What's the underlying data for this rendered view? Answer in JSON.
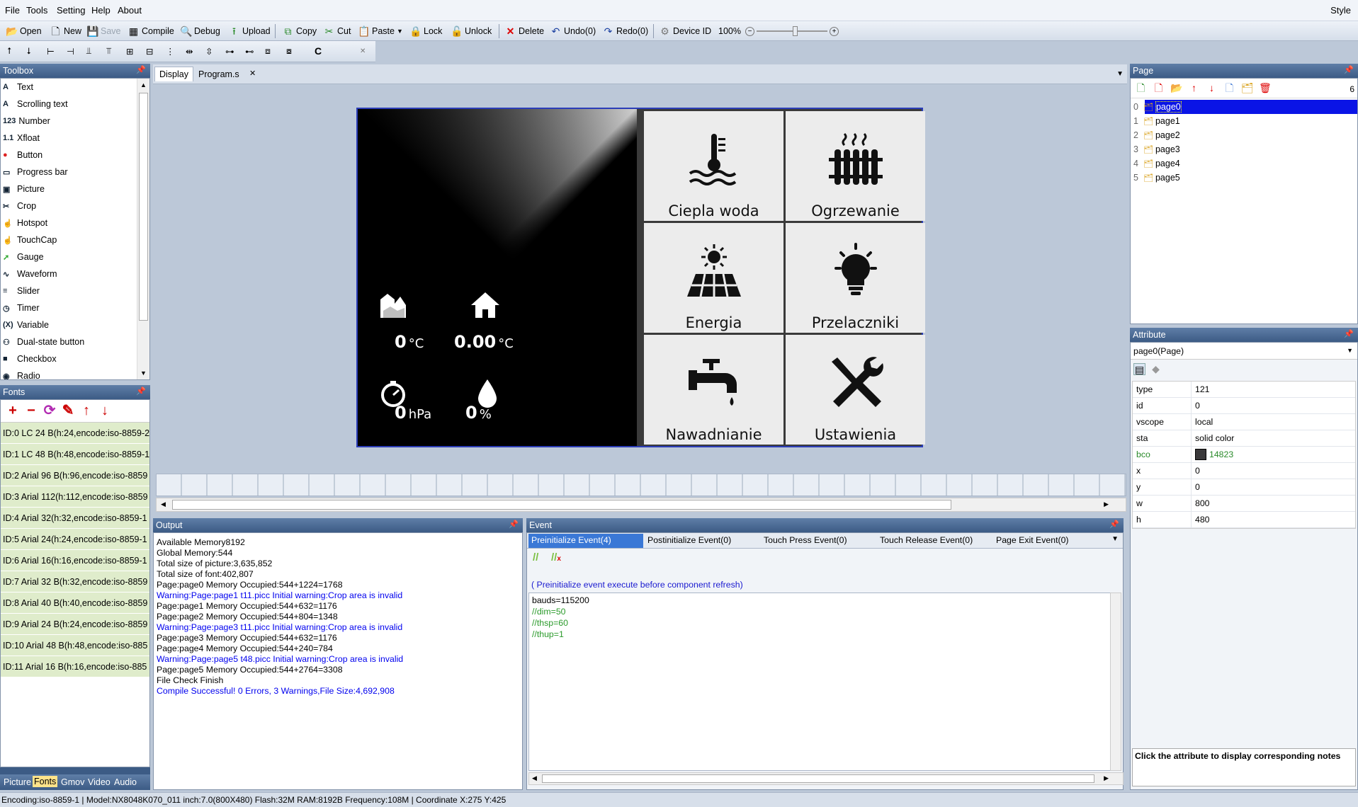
{
  "menu": {
    "file": "File",
    "tools": "Tools",
    "setting": "Setting",
    "help": "Help",
    "about": "About",
    "style": "Style"
  },
  "toolbar": {
    "open": "Open",
    "new": "New",
    "save": "Save",
    "compile": "Compile",
    "debug": "Debug",
    "upload": "Upload",
    "copy": "Copy",
    "cut": "Cut",
    "paste": "Paste",
    "lock": "Lock",
    "unlock": "Unlock",
    "delete": "Delete",
    "undo": "Undo(0)",
    "redo": "Redo(0)",
    "device_id": "Device ID",
    "zoom": "100%",
    "c_label": "C"
  },
  "toolbox": {
    "title": "Toolbox",
    "items": [
      {
        "icon": "A",
        "label": "Text"
      },
      {
        "icon": "A",
        "label": "Scrolling text"
      },
      {
        "icon": "123",
        "label": "Number"
      },
      {
        "icon": "1.1",
        "label": "Xfloat"
      },
      {
        "icon": "●",
        "label": "Button"
      },
      {
        "icon": "▭",
        "label": "Progress bar"
      },
      {
        "icon": "▣",
        "label": "Picture"
      },
      {
        "icon": "✂",
        "label": "Crop"
      },
      {
        "icon": "☝",
        "label": "Hotspot"
      },
      {
        "icon": "☝",
        "label": "TouchCap"
      },
      {
        "icon": "➚",
        "label": "Gauge"
      },
      {
        "icon": "∿",
        "label": "Waveform"
      },
      {
        "icon": "≡",
        "label": "Slider"
      },
      {
        "icon": "◷",
        "label": "Timer"
      },
      {
        "icon": "(X)",
        "label": "Variable"
      },
      {
        "icon": "⚇",
        "label": "Dual-state button"
      },
      {
        "icon": "■",
        "label": "Checkbox"
      },
      {
        "icon": "◉",
        "label": "Radio"
      }
    ]
  },
  "fonts": {
    "title": "Fonts",
    "items": [
      "ID:0  LC 24 B(h:24,encode:iso-8859-2",
      "ID:1  LC 48 B(h:48,encode:iso-8859-1",
      "ID:2  Arial 96 B(h:96,encode:iso-8859",
      "ID:3  Arial 112(h:112,encode:iso-8859",
      "ID:4  Arial 32(h:32,encode:iso-8859-1",
      "ID:5  Arial 24(h:24,encode:iso-8859-1",
      "ID:6  Arial 16(h:16,encode:iso-8859-1",
      "ID:7  Arial 32 B(h:32,encode:iso-8859",
      "ID:8  Arial 40 B(h:40,encode:iso-8859",
      "ID:9  Arial 24 B(h:24,encode:iso-8859",
      "ID:10  Arial 48 B(h:48,encode:iso-885",
      "ID:11  Arial 16 B(h:16,encode:iso-885"
    ]
  },
  "bottom_tabs": {
    "picture": "Picture",
    "fonts": "Fonts",
    "gmov": "Gmov",
    "video": "Video",
    "audio": "Audio"
  },
  "doc_tabs": {
    "display": "Display",
    "program": "Program.s"
  },
  "display": {
    "weather": {
      "outdoor_temp": "0",
      "outdoor_unit": "°C",
      "indoor_temp": "0.00",
      "indoor_unit": "°C",
      "pressure": "0",
      "pressure_unit": "hPa",
      "humidity": "0",
      "humidity_unit": "%"
    },
    "tiles": [
      {
        "label": "Ciepla woda",
        "icon": "water-heater-icon"
      },
      {
        "label": "Ogrzewanie",
        "icon": "radiator-icon"
      },
      {
        "label": "Energia",
        "icon": "solar-panel-icon"
      },
      {
        "label": "Przelaczniki",
        "icon": "lightbulb-icon"
      },
      {
        "label": "Nawadnianie",
        "icon": "water-tap-icon"
      },
      {
        "label": "Ustawienia",
        "icon": "tools-icon"
      }
    ]
  },
  "output": {
    "title": "Output",
    "lines": [
      {
        "t": "Available Memory8192",
        "warn": false
      },
      {
        "t": "Global Memory:544",
        "warn": false
      },
      {
        "t": "Total size of picture:3,635,852",
        "warn": false
      },
      {
        "t": "Total size of font:402,807",
        "warn": false
      },
      {
        "t": "Page:page0 Memory Occupied:544+1224=1768",
        "warn": false
      },
      {
        "t": "Warning:Page:page1 t11.picc Initial warning:Crop area is invalid",
        "warn": true
      },
      {
        "t": "Page:page1 Memory Occupied:544+632=1176",
        "warn": false
      },
      {
        "t": "Page:page2 Memory Occupied:544+804=1348",
        "warn": false
      },
      {
        "t": "Warning:Page:page3 t11.picc Initial warning:Crop area is invalid",
        "warn": true
      },
      {
        "t": "Page:page3 Memory Occupied:544+632=1176",
        "warn": false
      },
      {
        "t": "Page:page4 Memory Occupied:544+240=784",
        "warn": false
      },
      {
        "t": "Warning:Page:page5 t48.picc Initial warning:Crop area is invalid",
        "warn": true
      },
      {
        "t": "Page:page5 Memory Occupied:544+2764=3308",
        "warn": false
      },
      {
        "t": "File Check Finish",
        "warn": false
      },
      {
        "t": "Compile Successful! 0 Errors, 3 Warnings,File Size:4,692,908",
        "warn": true
      }
    ]
  },
  "event": {
    "title": "Event",
    "tabs": [
      "Preinitialize Event(4)",
      "Postinitialize Event(0)",
      "Touch Press Event(0)",
      "Touch Release Event(0)",
      "Page Exit Event(0)"
    ],
    "hint": "( Preinitialize event execute before component refresh)",
    "code": [
      {
        "t": "bauds=115200",
        "comment": false
      },
      {
        "t": "//dim=50",
        "comment": true
      },
      {
        "t": "//thsp=60",
        "comment": true
      },
      {
        "t": "//thup=1",
        "comment": true
      }
    ]
  },
  "page_panel": {
    "title": "Page",
    "count": "6",
    "pages": [
      {
        "n": "0",
        "name": "page0"
      },
      {
        "n": "1",
        "name": "page1"
      },
      {
        "n": "2",
        "name": "page2"
      },
      {
        "n": "3",
        "name": "page3"
      },
      {
        "n": "4",
        "name": "page4"
      },
      {
        "n": "5",
        "name": "page5"
      }
    ]
  },
  "attribute": {
    "title": "Attribute",
    "selected": "page0(Page)",
    "rows": [
      {
        "k": "type",
        "v": "121"
      },
      {
        "k": "id",
        "v": "0"
      },
      {
        "k": "vscope",
        "v": "local"
      },
      {
        "k": "sta",
        "v": "solid color"
      },
      {
        "k": "bco",
        "v": "14823"
      },
      {
        "k": "x",
        "v": "0"
      },
      {
        "k": "y",
        "v": "0"
      },
      {
        "k": "w",
        "v": "800"
      },
      {
        "k": "h",
        "v": "480"
      }
    ],
    "note": "Click the attribute to display corresponding notes"
  },
  "status": {
    "text": "Encoding:iso-8859-1 | Model:NX8048K070_011 inch:7.0(800X480) Flash:32M RAM:8192B Frequency:108M |    Coordinate X:275  Y:425"
  },
  "colors": {
    "accent": "#3c5b85",
    "selection": "#0a14e6",
    "bco_swatch": "#39383a"
  }
}
